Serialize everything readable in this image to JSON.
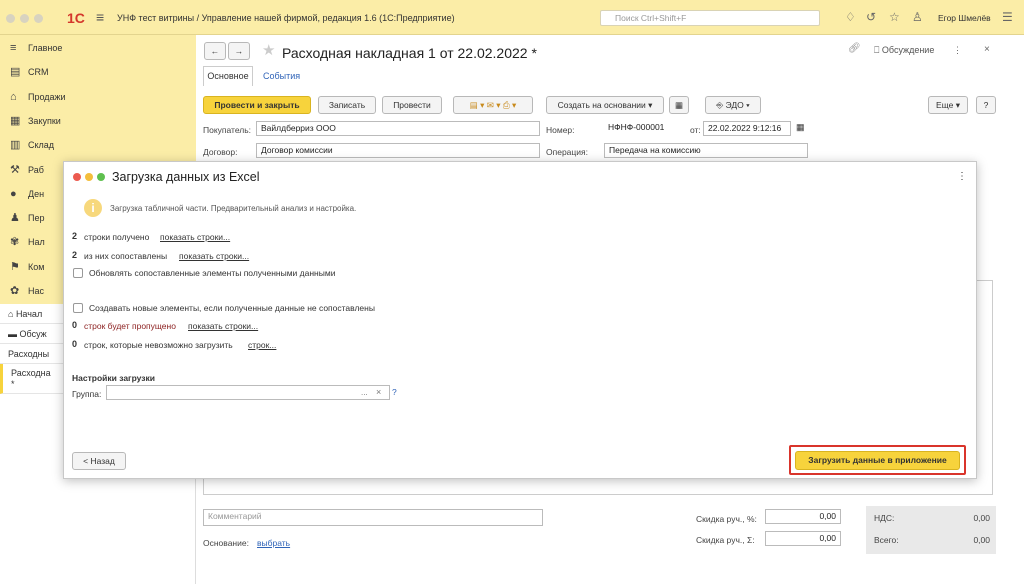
{
  "titlebar": {
    "logo": "1С",
    "app_title": "УНФ тест витрины / Управление нашей фирмой, редакция 1.6  (1С:Предприятие)",
    "search_placeholder": "Поиск Ctrl+Shift+F",
    "user": "Егор Шмелёв"
  },
  "sidebar": {
    "items": [
      {
        "label": "Главное",
        "icon": "≡"
      },
      {
        "label": "CRM",
        "icon": "▤"
      },
      {
        "label": "Продажи",
        "icon": "⌂"
      },
      {
        "label": "Закупки",
        "icon": "▦"
      },
      {
        "label": "Склад",
        "icon": "▥"
      },
      {
        "label": "Раб",
        "icon": "⚒"
      },
      {
        "label": "Ден",
        "icon": "●"
      },
      {
        "label": "Пер",
        "icon": "♟"
      },
      {
        "label": "Нал",
        "icon": "✾"
      },
      {
        "label": "Ком",
        "icon": "⚑"
      },
      {
        "label": "Нас",
        "icon": "✿"
      }
    ],
    "bottom": [
      {
        "label": "Начал",
        "icon": "⌂"
      },
      {
        "label": "Обсуж",
        "icon": "▬"
      },
      {
        "label": "Расходны"
      },
      {
        "label": "Расходна\n*"
      }
    ]
  },
  "form": {
    "title": "Расходная накладная 1 от 22.02.2022 *",
    "discuss": "Обсуждение",
    "tabs": [
      "Основное",
      "События"
    ],
    "buttons": {
      "post_close": "Провести и закрыть",
      "save": "Записать",
      "post": "Провести",
      "create_based": "Создать на основании",
      "edo": "ЭДО",
      "more": "Еще",
      "help": "?"
    },
    "buyer_label": "Покупатель:",
    "buyer_value": "Вайлдберриз ООО",
    "number_label": "Номер:",
    "number_value": "НФНФ-000001",
    "date_label": "от:",
    "date_value": "22.02.2022  9:12:16",
    "contract_label": "Договор:",
    "contract_value": "Договор комиссии",
    "operation_label": "Операция:",
    "operation_value": "Передача на комиссию",
    "comment_placeholder": "Комментарий",
    "basis_label": "Основание:",
    "basis_link": "выбрать",
    "discount_pct_label": "Скидка руч., %:",
    "discount_pct_value": "0,00",
    "discount_sum_label": "Скидка руч., Σ:",
    "discount_sum_value": "0,00",
    "vat_label": "НДС:",
    "vat_value": "0,00",
    "total_label": "Всего:",
    "total_value": "0,00"
  },
  "modal": {
    "title": "Загрузка данных из Excel",
    "hint": "Загрузка табличной части. Предварительный анализ и настройка.",
    "received_count": "2",
    "received_text": "строки получено",
    "received_link": "показать строки...",
    "matched_count": "2",
    "matched_text": "из них сопоставлены",
    "matched_link": "показать строки...",
    "update_checkbox": "Обновлять сопоставленные элементы полученными данными",
    "create_checkbox": "Создавать новые элементы, если полученные данные не сопоставлены",
    "skipped_count": "0",
    "skipped_text": "строк будет пропущено",
    "skipped_link": "показать строки...",
    "failed_count": "0",
    "failed_text": "строк, которые невозможно загрузить",
    "failed_link": "строк...",
    "settings_title": "Настройки загрузки",
    "group_label": "Группа:",
    "group_help": "?",
    "back_button": "< Назад",
    "load_button": "Загрузить данные в приложение"
  },
  "colors": {
    "accent_yellow": "#f7d33c",
    "sidebar_bg": "#fbeda7",
    "highlight_red": "#d9342b"
  }
}
